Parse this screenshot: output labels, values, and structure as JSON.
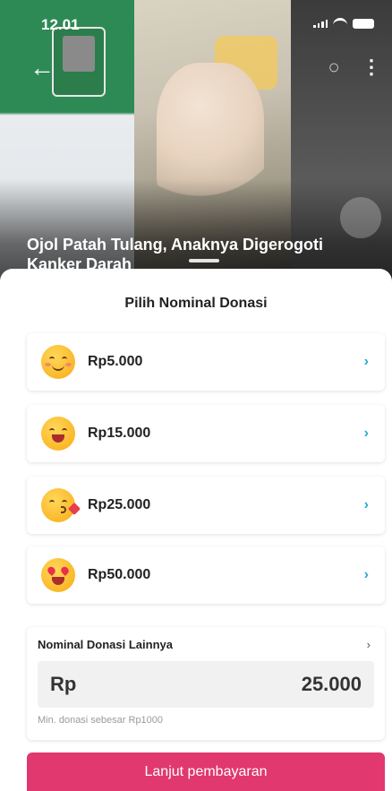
{
  "status_bar": {
    "time": "12.01"
  },
  "hero": {
    "title": "Ojol Patah Tulang, Anaknya Digerogoti Kanker Darah",
    "back_icon": "arrow-left-icon",
    "share_icon": "share-icon",
    "more_icon": "more-vertical-icon",
    "heart_icon": "heart-icon"
  },
  "sheet": {
    "title": "Pilih Nominal Donasi",
    "options": [
      {
        "emoji": "smile-emoji",
        "label": "Rp5.000"
      },
      {
        "emoji": "grin-emoji",
        "label": "Rp15.000"
      },
      {
        "emoji": "kiss-emoji",
        "label": "Rp25.000"
      },
      {
        "emoji": "heart-eyes-emoji",
        "label": "Rp50.000"
      }
    ],
    "custom": {
      "label": "Nominal Donasi Lainnya",
      "currency": "Rp",
      "value": "25.000",
      "min_note": "Min. donasi sebesar Rp1000"
    },
    "cta_label": "Lanjut pembayaran"
  },
  "colors": {
    "accent": "#e0386f",
    "chevron": "#2aa5d8"
  }
}
